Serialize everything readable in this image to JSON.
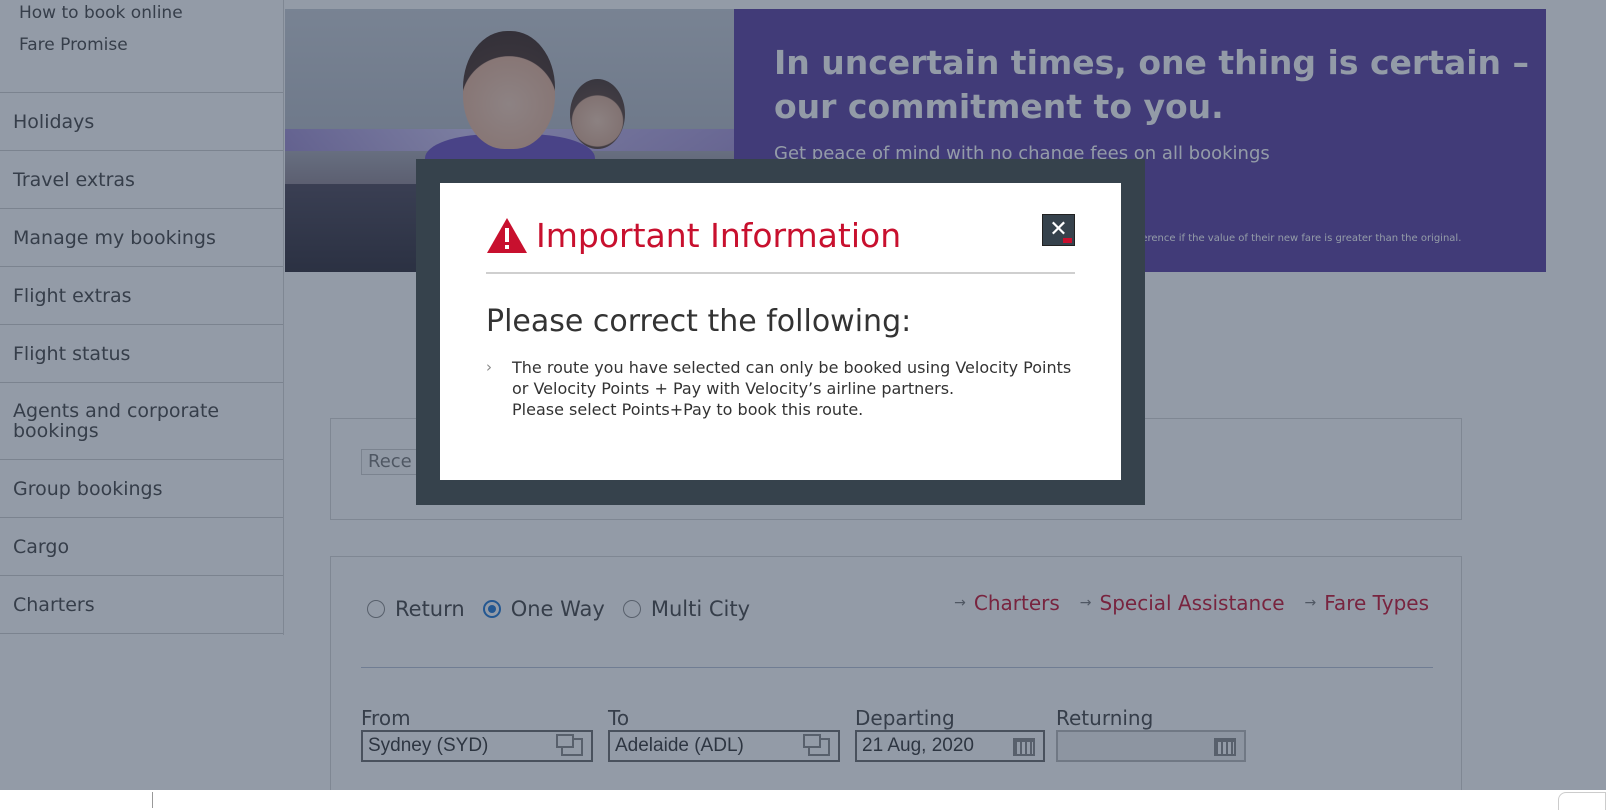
{
  "sidebar": {
    "sub_links": [
      "How to book online",
      "Fare Promise"
    ],
    "items": [
      {
        "label": "Holidays"
      },
      {
        "label": "Travel extras"
      },
      {
        "label": "Manage my bookings"
      },
      {
        "label": "Flight extras"
      },
      {
        "label": "Flight status"
      },
      {
        "label": "Agents and corporate bookings"
      },
      {
        "label": "Group bookings"
      },
      {
        "label": "Cargo"
      },
      {
        "label": "Charters"
      }
    ]
  },
  "hero": {
    "heading": "In uncertain times, one thing is certain – our commitment to you.",
    "subheading": "Get peace of mind with no change fees on all bookings",
    "fine_print": "e difference if the value of their new fare is greater than the original."
  },
  "recent_search": {
    "placeholder": "Rece"
  },
  "search": {
    "trip_types": [
      {
        "label": "Return",
        "checked": false
      },
      {
        "label": "One Way",
        "checked": true
      },
      {
        "label": "Multi City",
        "checked": false
      }
    ],
    "quick_links": [
      "Charters",
      "Special Assistance",
      "Fare Types"
    ],
    "from": {
      "label": "From",
      "value": "Sydney (SYD)"
    },
    "to": {
      "label": "To",
      "value": "Adelaide (ADL)"
    },
    "departing": {
      "label": "Departing",
      "value": "21 Aug, 2020"
    },
    "returning": {
      "label": "Returning",
      "value": ""
    }
  },
  "modal": {
    "title": "Important Information",
    "close_label": "✕",
    "heading": "Please correct the following:",
    "message_line1": "The route you have selected can only be booked using Velocity Points or Velocity Points + Pay with Velocity’s airline partners.",
    "message_line2": "Please select Points+Pay to book this route."
  },
  "colors": {
    "brand_red": "#c8102e",
    "promo_purple": "#5a3ea0",
    "modal_frame": "#36424c",
    "selected_radio": "#1e77d3"
  }
}
